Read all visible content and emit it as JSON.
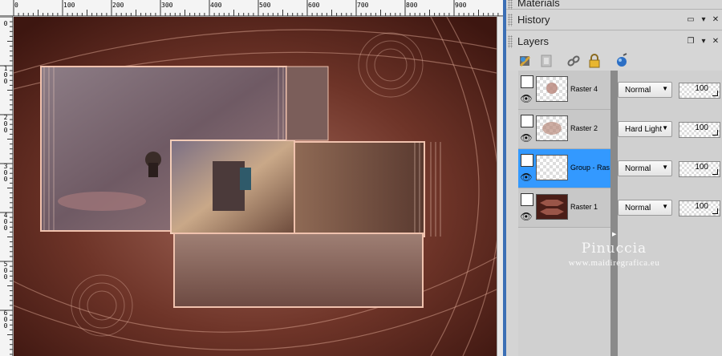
{
  "canvas": {
    "ruler_h_labels": [
      "0",
      "100",
      "200",
      "300",
      "400",
      "500",
      "600",
      "700",
      "800",
      "900"
    ],
    "ruler_v_labels": [
      "0",
      "100",
      "200",
      "300",
      "400",
      "500",
      "600"
    ]
  },
  "palettes": {
    "materials": {
      "title": "Materials"
    },
    "history": {
      "title": "History"
    },
    "layers": {
      "title": "Layers"
    }
  },
  "layers_toolbar": {
    "icons": [
      "new-raster-layer-icon",
      "new-mask-layer-icon",
      "link-icon",
      "lock-icon",
      "layer-properties-icon"
    ]
  },
  "layers": [
    {
      "name": "Raster 4",
      "blend": "Normal",
      "opacity": "100",
      "selected": false,
      "thumb": "raster4"
    },
    {
      "name": "Raster 2",
      "blend": "Hard Light",
      "opacity": "100",
      "selected": false,
      "thumb": "raster2"
    },
    {
      "name": "Group - Ras",
      "blend": "Normal",
      "opacity": "100",
      "selected": true,
      "thumb": "empty"
    },
    {
      "name": "Raster 1",
      "blend": "Normal",
      "opacity": "100",
      "selected": false,
      "thumb": "raster1"
    }
  ],
  "watermark": {
    "title": "Pinuccia",
    "url": "www.maidiregrafica.eu"
  },
  "colors": {
    "selection": "#3399ff",
    "divider": "#3c6fb5",
    "artwork_base": "#5d2b22"
  }
}
